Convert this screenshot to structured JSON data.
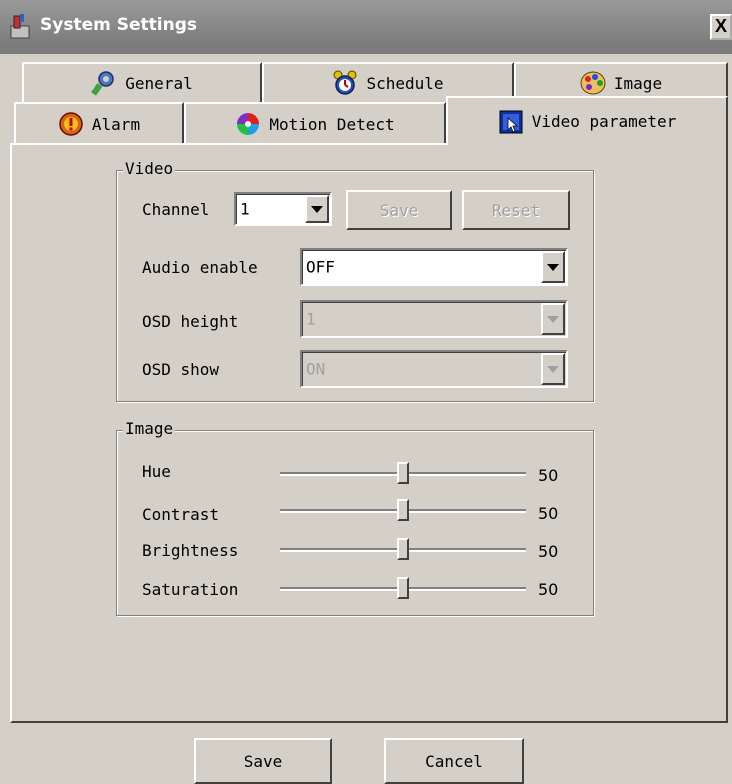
{
  "window": {
    "title": "System Settings",
    "close_glyph": "X"
  },
  "tabs": [
    {
      "label": "General",
      "icon": "wrench-icon"
    },
    {
      "label": "Schedule",
      "icon": "alarm-clock-icon"
    },
    {
      "label": "Image",
      "icon": "palette-icon"
    },
    {
      "label": "Alarm",
      "icon": "alarm-icon"
    },
    {
      "label": "Motion Detect",
      "icon": "color-wheel-icon"
    },
    {
      "label": "Video parameter",
      "icon": "video-parameter-icon",
      "active": true
    }
  ],
  "video": {
    "legend": "Video",
    "channel_label": "Channel",
    "channel_value": "1",
    "save_label": "Save",
    "reset_label": "Reset",
    "audio_label": "Audio enable",
    "audio_value": "OFF",
    "osd_height_label": "OSD height",
    "osd_height_value": "1",
    "osd_show_label": "OSD show",
    "osd_show_value": "ON"
  },
  "image": {
    "legend": "Image",
    "sliders": [
      {
        "label": "Hue",
        "value": "50",
        "fraction": 0.5
      },
      {
        "label": "Contrast",
        "value": "50",
        "fraction": 0.5
      },
      {
        "label": "Brightness",
        "value": "50",
        "fraction": 0.5
      },
      {
        "label": "Saturation",
        "value": "50",
        "fraction": 0.5
      }
    ]
  },
  "footer": {
    "save_label": "Save",
    "cancel_label": "Cancel"
  },
  "colors": {
    "face": "#d4d0c8",
    "titlebar": "#808080"
  }
}
